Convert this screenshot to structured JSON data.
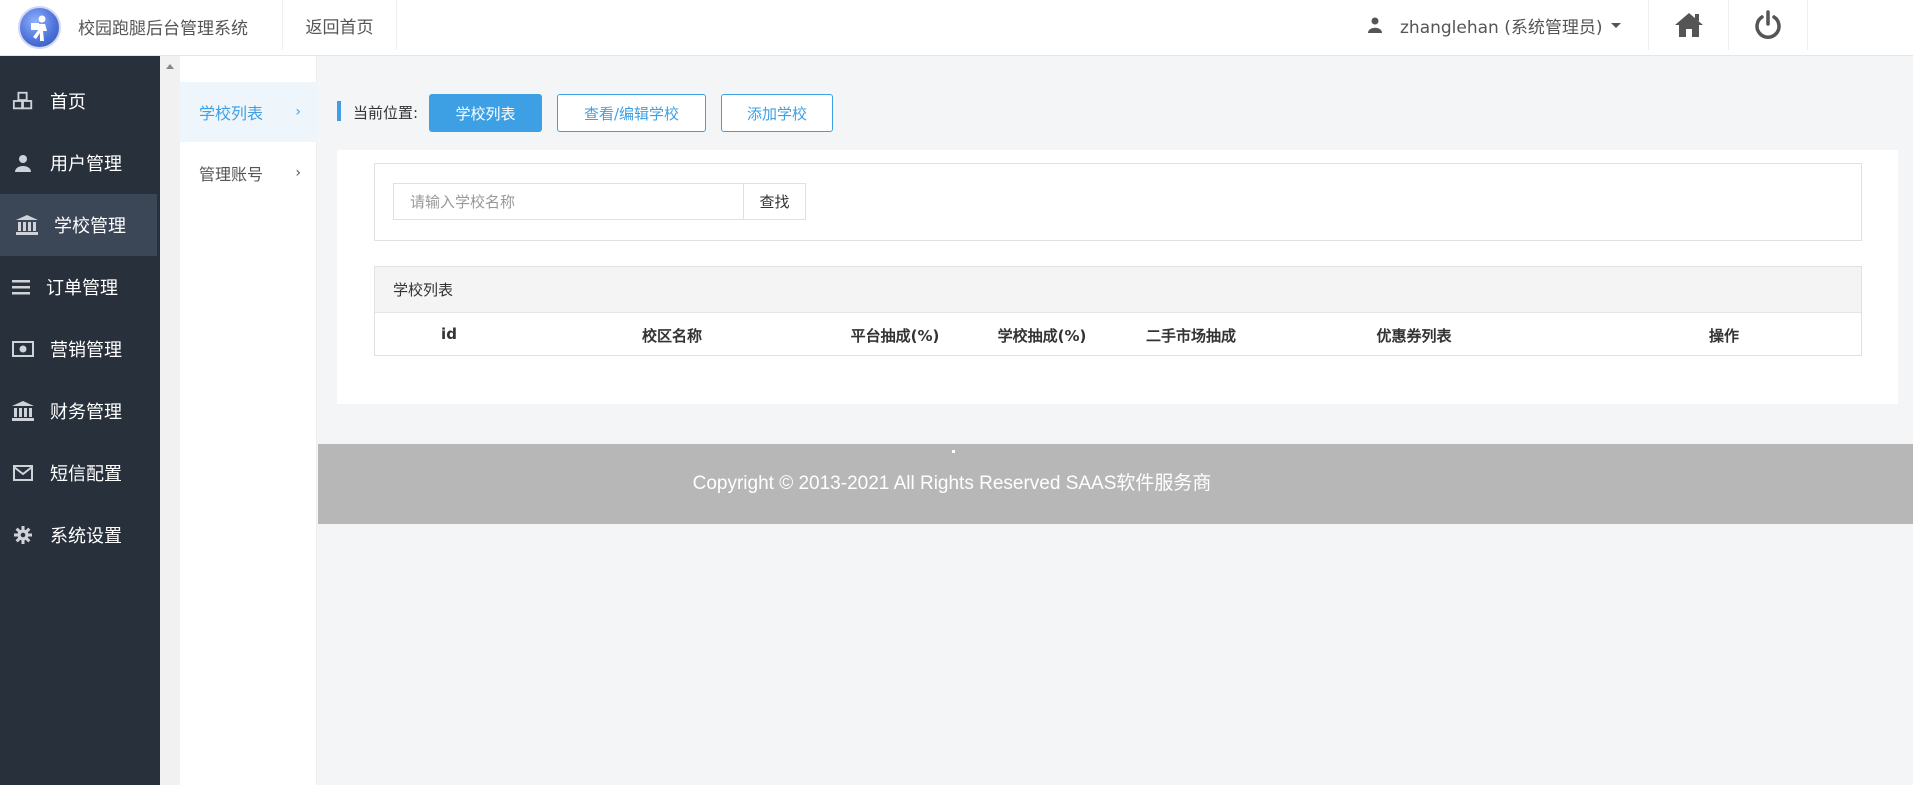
{
  "header": {
    "app_title": "校园跑腿后台管理系统",
    "back_home": "返回首页",
    "user": "zhanglehan (系统管理员)"
  },
  "sidebar": {
    "items": [
      {
        "label": "首页",
        "icon": "cubes-icon"
      },
      {
        "label": "用户管理",
        "icon": "user-icon"
      },
      {
        "label": "学校管理",
        "icon": "bank-icon",
        "active": true
      },
      {
        "label": "订单管理",
        "icon": "list-icon"
      },
      {
        "label": "营销管理",
        "icon": "money-icon"
      },
      {
        "label": "财务管理",
        "icon": "bank-icon"
      },
      {
        "label": "短信配置",
        "icon": "envelope-icon"
      },
      {
        "label": "系统设置",
        "icon": "gear-icon"
      }
    ]
  },
  "subnav": {
    "items": [
      {
        "label": "学校列表",
        "active": true
      },
      {
        "label": "管理账号"
      }
    ]
  },
  "breadcrumb": {
    "label": "当前位置:",
    "buttons": [
      "学校列表",
      "查看/编辑学校",
      "添加学校"
    ]
  },
  "search": {
    "placeholder": "请输入学校名称",
    "value": "",
    "button": "查找"
  },
  "table": {
    "title": "学校列表",
    "columns": [
      "id",
      "校区名称",
      "平台抽成(%)",
      "学校抽成(%)",
      "二手市场抽成",
      "优惠券列表",
      "操作"
    ]
  },
  "footer": {
    "copyright": "Copyright © 2013-2021 All Rights Reserved SAAS软件服务商"
  },
  "colors": {
    "accent": "#3ea0e4",
    "sidebar_bg": "#28303c",
    "sidebar_active": "#3b4656",
    "footer_bg": "#b6b7b6"
  }
}
